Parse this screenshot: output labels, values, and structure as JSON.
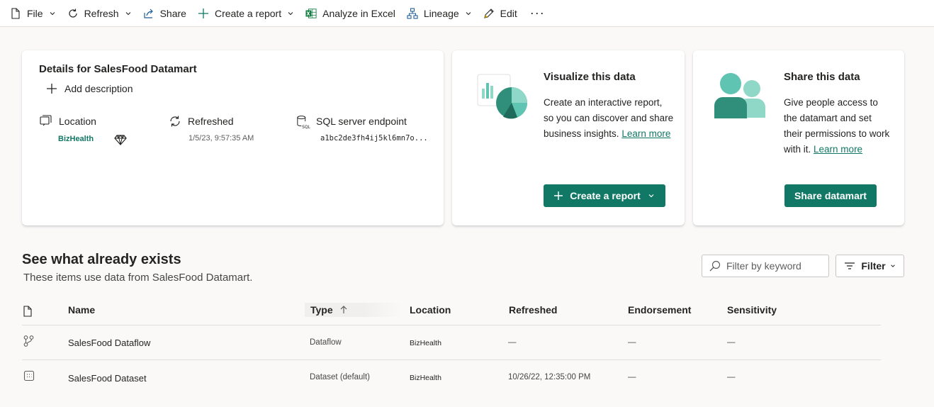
{
  "toolbar": {
    "file": "File",
    "refresh": "Refresh",
    "share": "Share",
    "create_report": "Create a report",
    "analyze": "Analyze in Excel",
    "lineage": "Lineage",
    "edit": "Edit",
    "more": "···"
  },
  "details": {
    "title": "Details for SalesFood Datamart",
    "add_description": "Add description",
    "location_label": "Location",
    "location_value": "BizHealth",
    "refreshed_label": "Refreshed",
    "refreshed_value": "1/5/23, 9:57:35 AM",
    "sql_label": "SQL server endpoint",
    "sql_value": "a1bc2de3fh4ij5kl6mn7o..."
  },
  "visualize": {
    "title": "Visualize this data",
    "body": "Create an interactive report, so you can discover and share business insights.",
    "link": "Learn more",
    "button": "Create a report"
  },
  "share": {
    "title": "Share this data",
    "body": "Give people access to the datamart and set their permissions to work with it.",
    "link": "Learn more",
    "button": "Share datamart"
  },
  "exists": {
    "title": "See what already exists",
    "subtitle": "These items use data from SalesFood Datamart.",
    "filter_placeholder": "Filter by keyword",
    "filter_button": "Filter"
  },
  "table": {
    "headers": {
      "name": "Name",
      "type": "Type",
      "location": "Location",
      "refreshed": "Refreshed",
      "endorsement": "Endorsement",
      "sensitivity": "Sensitivity"
    },
    "rows": [
      {
        "name": "SalesFood Dataflow",
        "type": "Dataflow",
        "location": "BizHealth",
        "refreshed": "—",
        "endorsement": "—",
        "sensitivity": "—",
        "icon": "dataflow-icon"
      },
      {
        "name": "SalesFood Dataset",
        "type": "Dataset (default)",
        "location": "BizHealth",
        "refreshed": "10/26/22, 12:35:00 PM",
        "endorsement": "—",
        "sensitivity": "—",
        "icon": "dataset-icon"
      }
    ]
  },
  "colors": {
    "accent": "#117865",
    "accent_light": "#5fc4b2"
  }
}
